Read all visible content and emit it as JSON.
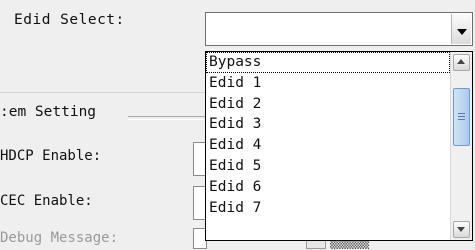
{
  "edid_label": "Edid Select:",
  "edid_dropdown": {
    "selected": "",
    "options": [
      "Bypass",
      "Edid 1",
      "Edid 2",
      "Edid 3",
      "Edid 4",
      "Edid 5",
      "Edid 6",
      "Edid 7"
    ],
    "scroll_position": 0.35
  },
  "group_title": ":em Setting",
  "fields": {
    "hdcp_label": "HDCP Enable:",
    "cec_label": "CEC Enable:",
    "debug_label": "Debug Message:"
  },
  "background_partial_text": "▒▒▒▒▒"
}
